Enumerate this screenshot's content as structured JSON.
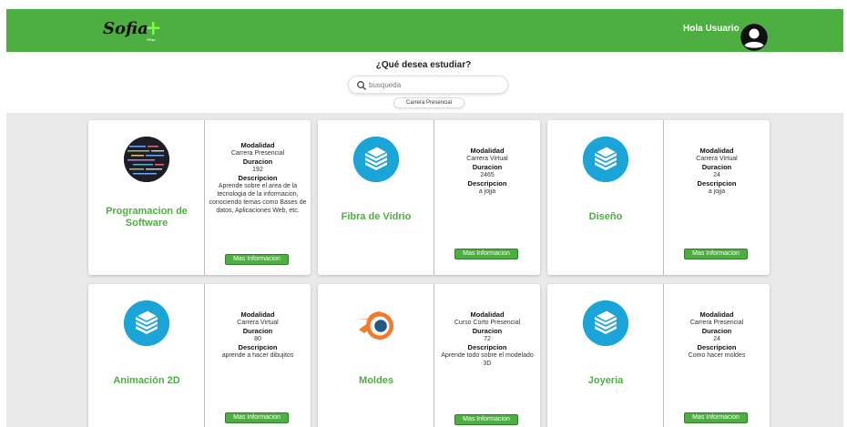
{
  "header": {
    "logo_text": "Sofia",
    "logo_plus": "+",
    "logo_sub": "Plus",
    "greeting": "Hola Usuario"
  },
  "search": {
    "question": "¿Qué desea estudiar?",
    "placeholder": "busqueda",
    "filter_chip": "Carrera Presencial"
  },
  "labels": {
    "modalidad": "Modalidad",
    "duracion": "Duracion",
    "descripcion": "Descripcion",
    "button": "Mas Informacion"
  },
  "cards": [
    {
      "title": "Programacion de Software",
      "icon": "code-screen-image",
      "modalidad": "Carrera Presencial",
      "duracion": "192",
      "descripcion": "Aprende sobre el area de la tecnologia de la informacion, conociendo temas como Bases de datos, Aplicaciones Web, etc."
    },
    {
      "title": "Fibra de Vidrio",
      "icon": "stack-of-books-icon",
      "modalidad": "Carrera Virtual",
      "duracion": "2465",
      "descripcion": "a jojja"
    },
    {
      "title": "Diseño",
      "icon": "stack-of-books-icon",
      "modalidad": "Carrera Virtual",
      "duracion": "24",
      "descripcion": "a jojja"
    },
    {
      "title": "Animación 2D",
      "icon": "stack-of-books-icon",
      "modalidad": "Carrera Virtual",
      "duracion": "80",
      "descripcion": "aprende a hacer dibujitos"
    },
    {
      "title": "Moldes",
      "icon": "blender-logo-icon",
      "modalidad": "Curso Corto Presencial",
      "duracion": "72",
      "descripcion": "Aprende todo sobre el modelado 3D"
    },
    {
      "title": "Joyeria",
      "icon": "stack-of-books-icon",
      "modalidad": "Carrera Presencial",
      "duracion": "24",
      "descripcion": "Como hacer moldes"
    }
  ],
  "colors": {
    "brand_green": "#4caf3f",
    "icon_blue": "#1ba4d8",
    "logo_plus": "#7dfc44"
  }
}
